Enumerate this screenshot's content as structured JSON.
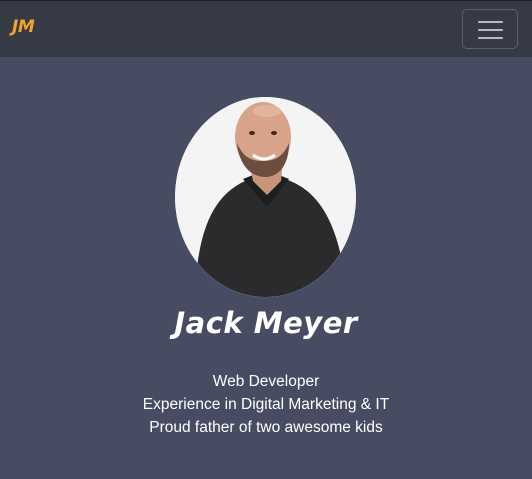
{
  "navbar": {
    "brand": "JM",
    "toggler_icon": "hamburger-menu-icon"
  },
  "profile": {
    "photo_icon": "profile-photo",
    "name": "Jack Meyer",
    "bio_lines": [
      "Web Developer",
      "Experience in Digital Marketing & IT",
      "Proud father of two awesome kids"
    ]
  },
  "colors": {
    "background": "#484c63",
    "navbar": "#363a45",
    "brand": "#f0a32b",
    "text": "#ffffff"
  }
}
